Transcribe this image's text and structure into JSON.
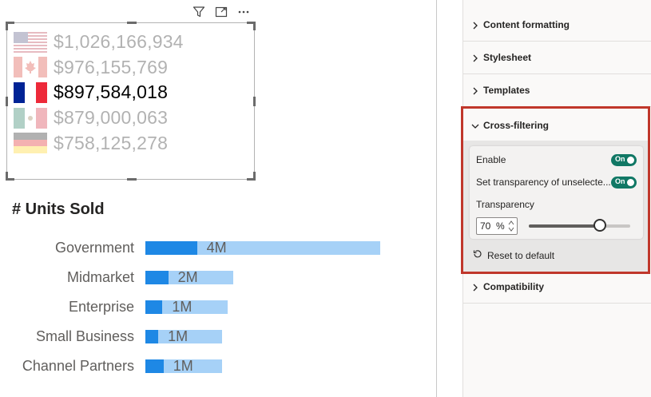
{
  "canvas": {
    "countries": [
      {
        "flag": "us-flag-icon",
        "amount": "$1,026,166,934",
        "selected": false
      },
      {
        "flag": "canada-flag-icon",
        "amount": "$976,155,769",
        "selected": false
      },
      {
        "flag": "france-flag-icon",
        "amount": "$897,584,018",
        "selected": true
      },
      {
        "flag": "mexico-flag-icon",
        "amount": "$879,000,063",
        "selected": false
      },
      {
        "flag": "germany-flag-icon",
        "amount": "$758,125,278",
        "selected": false
      }
    ],
    "chart_title": "# Units Sold"
  },
  "chart_data": {
    "type": "bar",
    "orientation": "horizontal",
    "title": "# Units Sold",
    "categories": [
      "Government",
      "Midmarket",
      "Enterprise",
      "Small Business",
      "Channel Partners"
    ],
    "data_labels": [
      "4M",
      "2M",
      "1M",
      "1M",
      "1M"
    ],
    "series": [
      {
        "values": [
          4.0,
          1.5,
          1.4,
          1.3,
          1.3
        ]
      },
      {
        "values": [
          0.88,
          0.39,
          0.29,
          0.22,
          0.31
        ]
      }
    ],
    "xlim": [
      0,
      4.0
    ],
    "colors": {
      "total": "#a6d1f7",
      "highlighted": "#1e88e5"
    }
  },
  "pane": {
    "sections": [
      {
        "label": "Content formatting"
      },
      {
        "label": "Stylesheet"
      },
      {
        "label": "Templates"
      },
      {
        "label": "Compatibility"
      }
    ],
    "cross_filtering": {
      "label": "Cross-filtering",
      "enable_label": "Enable",
      "enable_toggle": "On",
      "transparency_toggle_label": "Set transparency of unselecte...",
      "transparency_toggle": "On",
      "transparency_label": "Transparency",
      "transparency_value": "70",
      "transparency_unit": "%",
      "transparency_level": 0.7,
      "reset_label": "Reset to default"
    }
  },
  "colors": {
    "highlight_border": "#c0372b",
    "toggle_on": "#117865"
  }
}
